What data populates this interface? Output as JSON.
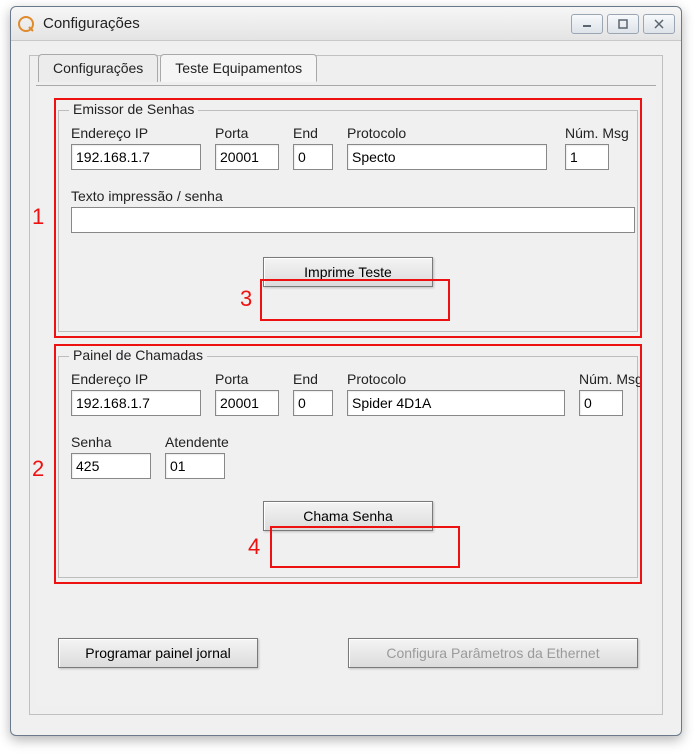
{
  "window": {
    "title": "Configurações"
  },
  "tabs": {
    "config_label": "Configurações",
    "teste_label": "Teste Equipamentos"
  },
  "emissor": {
    "legend": "Emissor de Senhas",
    "ip_label": "Endereço IP",
    "ip_value": "192.168.1.7",
    "porta_label": "Porta",
    "porta_value": "20001",
    "end_label": "End",
    "end_value": "0",
    "proto_label": "Protocolo",
    "proto_value": "Specto",
    "nmsg_label": "Núm. Msg",
    "nmsg_value": "1",
    "texto_label": "Texto impressão / senha",
    "texto_value": "",
    "print_btn": "Imprime Teste"
  },
  "painel": {
    "legend": "Painel de Chamadas",
    "ip_label": "Endereço IP",
    "ip_value": "192.168.1.7",
    "porta_label": "Porta",
    "porta_value": "20001",
    "end_label": "End",
    "end_value": "0",
    "proto_label": "Protocolo",
    "proto_value": "Spider 4D1A",
    "nmsg_label": "Núm. Msg",
    "nmsg_value": "0",
    "senha_label": "Senha",
    "senha_value": "425",
    "atend_label": "Atendente",
    "atend_value": "01",
    "call_btn": "Chama Senha"
  },
  "bottom": {
    "prog_btn": "Programar painel jornal",
    "eth_btn": "Configura Parâmetros da Ethernet"
  },
  "annotations": {
    "n1": "1",
    "n2": "2",
    "n3": "3",
    "n4": "4"
  }
}
